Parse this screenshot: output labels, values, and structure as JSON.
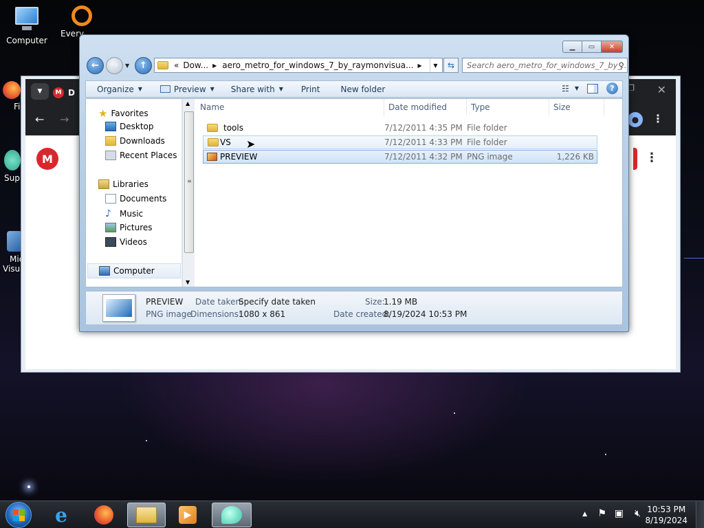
{
  "desktop": {
    "icons": [
      {
        "label": "Computer"
      },
      {
        "label": "Every"
      },
      {
        "label": "Fi"
      },
      {
        "label": "Sup"
      },
      {
        "label": "Mic"
      },
      {
        "label": "Visua"
      }
    ]
  },
  "browser": {
    "tab_text": "D",
    "logo_letter": "M"
  },
  "explorer": {
    "address": {
      "chevrons": "«",
      "segments": [
        "Dow...",
        "aero_metro_for_windows_7_by_raymonvisua..."
      ]
    },
    "search_placeholder": "Search aero_metro_for_windows_7_by_...",
    "toolbar": {
      "organize": "Organize",
      "preview": "Preview",
      "share_with": "Share with",
      "print": "Print",
      "new_folder": "New folder"
    },
    "nav": {
      "favorites": "Favorites",
      "desktop": "Desktop",
      "downloads": "Downloads",
      "recent_places": "Recent Places",
      "libraries": "Libraries",
      "documents": "Documents",
      "music": "Music",
      "pictures": "Pictures",
      "videos": "Videos",
      "computer": "Computer"
    },
    "columns": {
      "name": "Name",
      "date": "Date modified",
      "type": "Type",
      "size": "Size"
    },
    "files": [
      {
        "name": "tools",
        "date": "7/12/2011 4:35 PM",
        "type": "File folder",
        "size": ""
      },
      {
        "name": "VS",
        "date": "7/12/2011 4:33 PM",
        "type": "File folder",
        "size": ""
      },
      {
        "name": "PREVIEW",
        "date": "7/12/2011 4:32 PM",
        "type": "PNG image",
        "size": "1,226 KB"
      }
    ],
    "details": {
      "name": "PREVIEW",
      "kind": "PNG image",
      "date_taken_label": "Date taken:",
      "date_taken_value": "Specify date taken",
      "dimensions_label": "Dimensions:",
      "dimensions_value": "1080 x 861",
      "size_label": "Size:",
      "size_value": "1.19 MB",
      "date_created_label": "Date created:",
      "date_created_value": "8/19/2024 10:53 PM"
    }
  },
  "taskbar": {
    "time": "10:53 PM",
    "date": "8/19/2024"
  },
  "colors": {
    "selection": "#cfe3f7",
    "accent": "#2c6bb5",
    "mega_red": "#d9272e"
  }
}
